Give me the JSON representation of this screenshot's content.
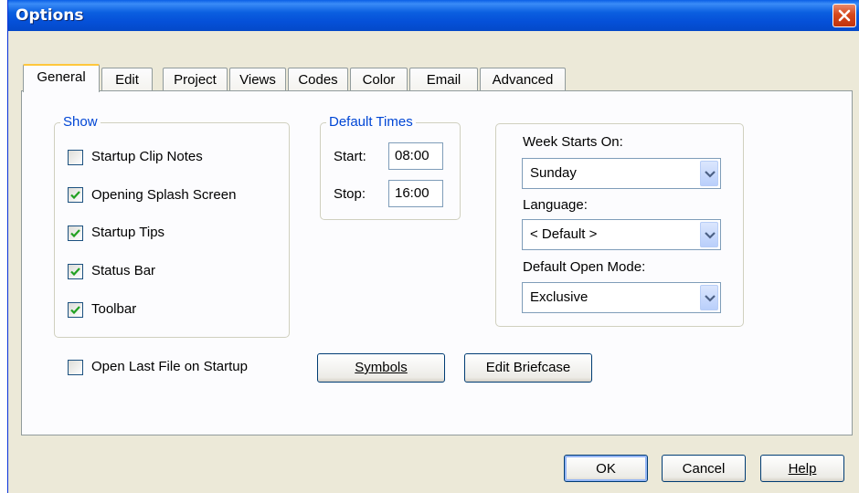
{
  "window": {
    "title": "Options"
  },
  "tabs": [
    {
      "label": "General",
      "active": true
    },
    {
      "label": "Edit"
    },
    {
      "label": "Project"
    },
    {
      "label": "Views"
    },
    {
      "label": "Codes"
    },
    {
      "label": "Color"
    },
    {
      "label": "Email"
    },
    {
      "label": "Advanced"
    }
  ],
  "show_group": {
    "label": "Show",
    "items": [
      {
        "label": "Startup Clip Notes",
        "checked": false
      },
      {
        "label": "Opening Splash Screen",
        "checked": true
      },
      {
        "label": "Startup Tips",
        "checked": true
      },
      {
        "label": "Status Bar",
        "checked": true
      },
      {
        "label": "Toolbar",
        "checked": true
      }
    ]
  },
  "default_times": {
    "label": "Default Times",
    "start_label": "Start:",
    "start_value": "08:00",
    "stop_label": "Stop:",
    "stop_value": "16:00"
  },
  "settings": {
    "week_label": "Week Starts On:",
    "week_value": "Sunday",
    "language_label": "Language:",
    "language_value": "< Default >",
    "mode_label": "Default Open Mode:",
    "mode_value": "Exclusive"
  },
  "open_last": {
    "label": "Open Last File on Startup",
    "checked": false
  },
  "buttons": {
    "symbols": "Symbols",
    "edit_briefcase": "Edit Briefcase",
    "ok": "OK",
    "cancel": "Cancel",
    "help": "Help"
  },
  "icons": {
    "close": "close-icon",
    "check": "check-icon",
    "dropdown": "chevron-down-icon"
  },
  "colors": {
    "titlebar": "#0550d8",
    "group_label": "#0046d5",
    "close": "#d6481c",
    "face": "#ece9d8"
  }
}
